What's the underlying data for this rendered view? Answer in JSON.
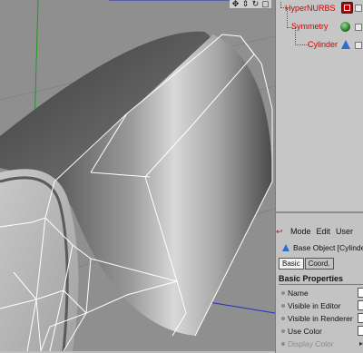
{
  "viewport": {
    "nav_icons": [
      "move-icon",
      "zoom-icon",
      "rotate-icon",
      "maximize-icon"
    ],
    "nav_glyphs": [
      "✥",
      "⇕",
      "↻",
      "▢"
    ]
  },
  "object_manager": {
    "items": [
      {
        "label": "HyperNURBS",
        "icon": "hypernurbs-icon"
      },
      {
        "label": "Symmetry",
        "icon": "symmetry-icon"
      },
      {
        "label": "Cylinder",
        "icon": "cylinder-icon"
      }
    ]
  },
  "attributes": {
    "menu": {
      "mode": "Mode",
      "edit": "Edit",
      "user": "User"
    },
    "object_title": "Base Object [Cylinde",
    "tabs": {
      "basic": "Basic",
      "coord": "Coord."
    },
    "section_title": "Basic Properties",
    "properties": [
      {
        "label": "Name"
      },
      {
        "label": "Visible in Editor"
      },
      {
        "label": "Visible in Renderer"
      },
      {
        "label": "Use Color"
      },
      {
        "label": "Display Color"
      }
    ]
  }
}
